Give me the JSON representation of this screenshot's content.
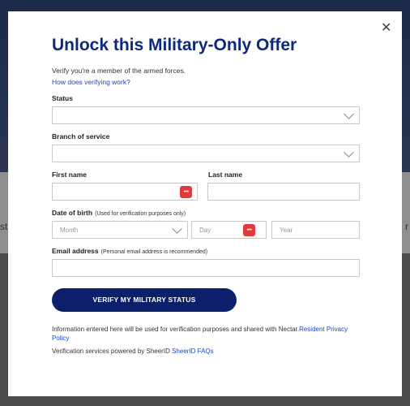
{
  "background": {
    "left_text": "st",
    "right_text": "r"
  },
  "modal": {
    "close_glyph": "✕",
    "title": "Unlock this Military-Only Offer",
    "intro": "Verify you're a member of the armed forces.",
    "how_link": "How does verifying work?",
    "fields": {
      "status_label": "Status",
      "branch_label": "Branch of service",
      "first_name_label": "First name",
      "last_name_label": "Last name",
      "dob_label": "Date of birth",
      "dob_note": "(Used for verification purposes only)",
      "month_placeholder": "Month",
      "day_placeholder": "Day",
      "year_placeholder": "Year",
      "email_label": "Email address",
      "email_note": "(Personal email address is recommended)"
    },
    "submit_label": "VERIFY MY MILITARY STATUS",
    "info_text": "Information entered here will be used for verification purposes and shared with Nectar.",
    "info_link": "Resident Privacy Policy",
    "powered_text": "Verification services powered by SheerID ",
    "powered_link": "SheerID FAQs",
    "password_badge_glyph": "•••"
  },
  "colors": {
    "title": "#0b2a7a",
    "button": "#0b1f6b",
    "link": "#1f47b8",
    "badge": "#e03a3a"
  }
}
